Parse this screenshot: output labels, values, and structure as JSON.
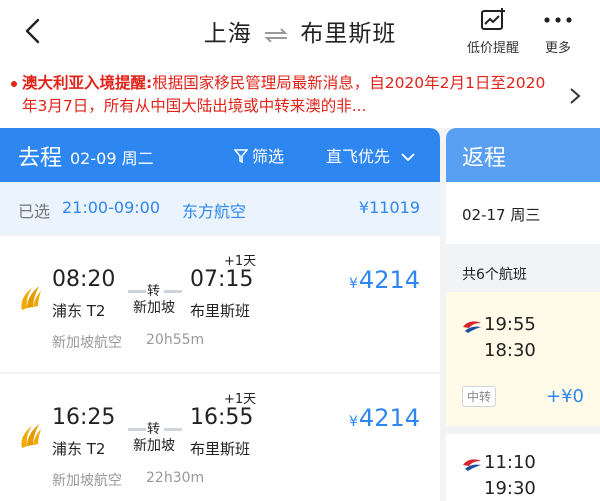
{
  "header": {
    "origin": "上海",
    "destination": "布里斯班",
    "price_alert_label": "低价提醒",
    "more_label": "更多"
  },
  "notice": {
    "title": "澳大利亚入境提醒:",
    "body": "根据国家移民管理局最新消息，自2020年2月1日至2020年3月7日，所有从中国大陆出境或中转来澳的非..."
  },
  "outbound": {
    "label": "去程",
    "date": "02-09 周二",
    "filter_label": "筛选",
    "sort_label": "直飞优先",
    "selected": {
      "prefix": "已选",
      "time": "21:00-09:00",
      "airline": "东方航空",
      "price": "¥11019"
    },
    "flights": [
      {
        "dep_time": "08:20",
        "arr_time": "07:15",
        "plus_day": "+1天",
        "via_word": "转",
        "dep_airport": "浦东 T2",
        "via_city": "新加坡",
        "arr_airport": "布里斯班",
        "airline": "新加坡航空",
        "duration": "20h55m",
        "currency": "¥",
        "price": "4214"
      },
      {
        "dep_time": "16:25",
        "arr_time": "16:55",
        "plus_day": "+1天",
        "via_word": "转",
        "dep_airport": "浦东 T2",
        "via_city": "新加坡",
        "arr_airport": "布里斯班",
        "airline": "新加坡航空",
        "duration": "22h30m",
        "currency": "¥",
        "price": "4214"
      }
    ]
  },
  "return": {
    "label": "返程",
    "date": "02-17 周三",
    "count": "共6个航班",
    "flights": [
      {
        "dep_time": "19:55",
        "arr_time": "18:30",
        "tag": "中转",
        "price_diff": "+¥0"
      },
      {
        "dep_time": "11:10",
        "arr_time": "19:30"
      }
    ]
  },
  "colors": {
    "accent": "#2e87f0",
    "return_header": "#5aa0f2",
    "alert": "#e2231a",
    "selected_bg": "#fffbe8"
  }
}
